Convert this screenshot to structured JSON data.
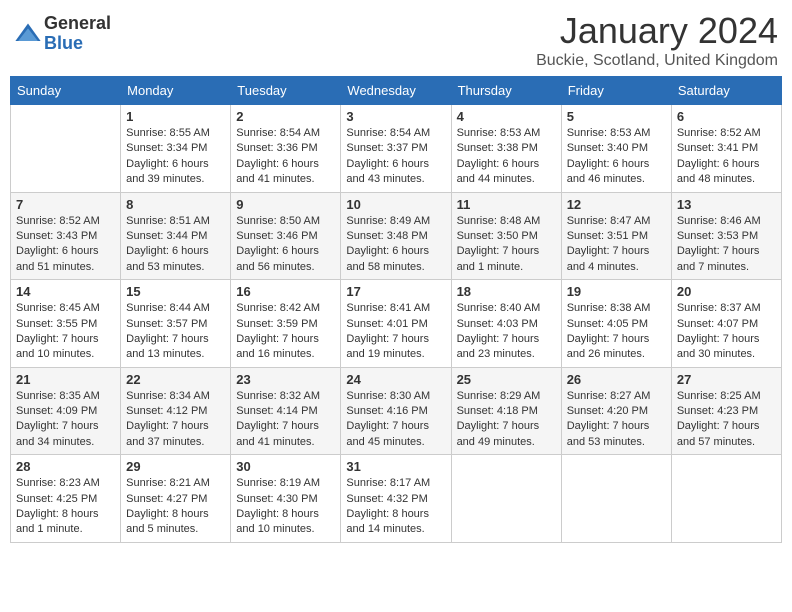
{
  "header": {
    "logo_general": "General",
    "logo_blue": "Blue",
    "title": "January 2024",
    "location": "Buckie, Scotland, United Kingdom"
  },
  "days_of_week": [
    "Sunday",
    "Monday",
    "Tuesday",
    "Wednesday",
    "Thursday",
    "Friday",
    "Saturday"
  ],
  "weeks": [
    [
      {
        "day": "",
        "sunrise": "",
        "sunset": "",
        "daylight": ""
      },
      {
        "day": "1",
        "sunrise": "Sunrise: 8:55 AM",
        "sunset": "Sunset: 3:34 PM",
        "daylight": "Daylight: 6 hours and 39 minutes."
      },
      {
        "day": "2",
        "sunrise": "Sunrise: 8:54 AM",
        "sunset": "Sunset: 3:36 PM",
        "daylight": "Daylight: 6 hours and 41 minutes."
      },
      {
        "day": "3",
        "sunrise": "Sunrise: 8:54 AM",
        "sunset": "Sunset: 3:37 PM",
        "daylight": "Daylight: 6 hours and 43 minutes."
      },
      {
        "day": "4",
        "sunrise": "Sunrise: 8:53 AM",
        "sunset": "Sunset: 3:38 PM",
        "daylight": "Daylight: 6 hours and 44 minutes."
      },
      {
        "day": "5",
        "sunrise": "Sunrise: 8:53 AM",
        "sunset": "Sunset: 3:40 PM",
        "daylight": "Daylight: 6 hours and 46 minutes."
      },
      {
        "day": "6",
        "sunrise": "Sunrise: 8:52 AM",
        "sunset": "Sunset: 3:41 PM",
        "daylight": "Daylight: 6 hours and 48 minutes."
      }
    ],
    [
      {
        "day": "7",
        "sunrise": "Sunrise: 8:52 AM",
        "sunset": "Sunset: 3:43 PM",
        "daylight": "Daylight: 6 hours and 51 minutes."
      },
      {
        "day": "8",
        "sunrise": "Sunrise: 8:51 AM",
        "sunset": "Sunset: 3:44 PM",
        "daylight": "Daylight: 6 hours and 53 minutes."
      },
      {
        "day": "9",
        "sunrise": "Sunrise: 8:50 AM",
        "sunset": "Sunset: 3:46 PM",
        "daylight": "Daylight: 6 hours and 56 minutes."
      },
      {
        "day": "10",
        "sunrise": "Sunrise: 8:49 AM",
        "sunset": "Sunset: 3:48 PM",
        "daylight": "Daylight: 6 hours and 58 minutes."
      },
      {
        "day": "11",
        "sunrise": "Sunrise: 8:48 AM",
        "sunset": "Sunset: 3:50 PM",
        "daylight": "Daylight: 7 hours and 1 minute."
      },
      {
        "day": "12",
        "sunrise": "Sunrise: 8:47 AM",
        "sunset": "Sunset: 3:51 PM",
        "daylight": "Daylight: 7 hours and 4 minutes."
      },
      {
        "day": "13",
        "sunrise": "Sunrise: 8:46 AM",
        "sunset": "Sunset: 3:53 PM",
        "daylight": "Daylight: 7 hours and 7 minutes."
      }
    ],
    [
      {
        "day": "14",
        "sunrise": "Sunrise: 8:45 AM",
        "sunset": "Sunset: 3:55 PM",
        "daylight": "Daylight: 7 hours and 10 minutes."
      },
      {
        "day": "15",
        "sunrise": "Sunrise: 8:44 AM",
        "sunset": "Sunset: 3:57 PM",
        "daylight": "Daylight: 7 hours and 13 minutes."
      },
      {
        "day": "16",
        "sunrise": "Sunrise: 8:42 AM",
        "sunset": "Sunset: 3:59 PM",
        "daylight": "Daylight: 7 hours and 16 minutes."
      },
      {
        "day": "17",
        "sunrise": "Sunrise: 8:41 AM",
        "sunset": "Sunset: 4:01 PM",
        "daylight": "Daylight: 7 hours and 19 minutes."
      },
      {
        "day": "18",
        "sunrise": "Sunrise: 8:40 AM",
        "sunset": "Sunset: 4:03 PM",
        "daylight": "Daylight: 7 hours and 23 minutes."
      },
      {
        "day": "19",
        "sunrise": "Sunrise: 8:38 AM",
        "sunset": "Sunset: 4:05 PM",
        "daylight": "Daylight: 7 hours and 26 minutes."
      },
      {
        "day": "20",
        "sunrise": "Sunrise: 8:37 AM",
        "sunset": "Sunset: 4:07 PM",
        "daylight": "Daylight: 7 hours and 30 minutes."
      }
    ],
    [
      {
        "day": "21",
        "sunrise": "Sunrise: 8:35 AM",
        "sunset": "Sunset: 4:09 PM",
        "daylight": "Daylight: 7 hours and 34 minutes."
      },
      {
        "day": "22",
        "sunrise": "Sunrise: 8:34 AM",
        "sunset": "Sunset: 4:12 PM",
        "daylight": "Daylight: 7 hours and 37 minutes."
      },
      {
        "day": "23",
        "sunrise": "Sunrise: 8:32 AM",
        "sunset": "Sunset: 4:14 PM",
        "daylight": "Daylight: 7 hours and 41 minutes."
      },
      {
        "day": "24",
        "sunrise": "Sunrise: 8:30 AM",
        "sunset": "Sunset: 4:16 PM",
        "daylight": "Daylight: 7 hours and 45 minutes."
      },
      {
        "day": "25",
        "sunrise": "Sunrise: 8:29 AM",
        "sunset": "Sunset: 4:18 PM",
        "daylight": "Daylight: 7 hours and 49 minutes."
      },
      {
        "day": "26",
        "sunrise": "Sunrise: 8:27 AM",
        "sunset": "Sunset: 4:20 PM",
        "daylight": "Daylight: 7 hours and 53 minutes."
      },
      {
        "day": "27",
        "sunrise": "Sunrise: 8:25 AM",
        "sunset": "Sunset: 4:23 PM",
        "daylight": "Daylight: 7 hours and 57 minutes."
      }
    ],
    [
      {
        "day": "28",
        "sunrise": "Sunrise: 8:23 AM",
        "sunset": "Sunset: 4:25 PM",
        "daylight": "Daylight: 8 hours and 1 minute."
      },
      {
        "day": "29",
        "sunrise": "Sunrise: 8:21 AM",
        "sunset": "Sunset: 4:27 PM",
        "daylight": "Daylight: 8 hours and 5 minutes."
      },
      {
        "day": "30",
        "sunrise": "Sunrise: 8:19 AM",
        "sunset": "Sunset: 4:30 PM",
        "daylight": "Daylight: 8 hours and 10 minutes."
      },
      {
        "day": "31",
        "sunrise": "Sunrise: 8:17 AM",
        "sunset": "Sunset: 4:32 PM",
        "daylight": "Daylight: 8 hours and 14 minutes."
      },
      {
        "day": "",
        "sunrise": "",
        "sunset": "",
        "daylight": ""
      },
      {
        "day": "",
        "sunrise": "",
        "sunset": "",
        "daylight": ""
      },
      {
        "day": "",
        "sunrise": "",
        "sunset": "",
        "daylight": ""
      }
    ]
  ]
}
